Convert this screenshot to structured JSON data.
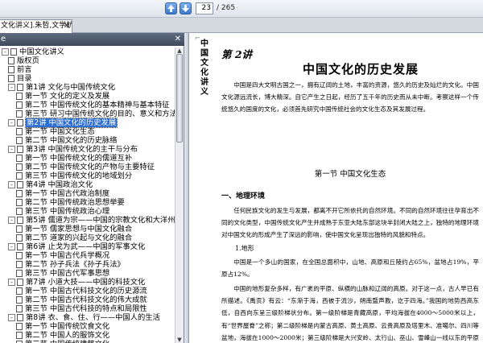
{
  "toolbar": {
    "prev_icon": "arrow-up-icon",
    "next_icon": "arrow-down-icon",
    "page_current": "23",
    "page_total": "/ 265",
    "accent": "#3c78c8"
  },
  "tab": {
    "title": "文化讲义].朱哲,文学航",
    "close": "✕"
  },
  "sidebar": {
    "header": "e",
    "close": "✕",
    "tree": [
      {
        "label": "中国文化讲义",
        "level": 0,
        "expander": "-"
      },
      {
        "label": "版权页",
        "level": 1
      },
      {
        "label": "前言",
        "level": 1
      },
      {
        "label": "目录",
        "level": 1
      },
      {
        "label": "第1讲   文化与中国传统文化",
        "level": 1,
        "expander": "-"
      },
      {
        "label": "第一节   文化的定义及发展",
        "level": 2
      },
      {
        "label": "第二节   中国传统文化的基本精神与基本特征",
        "level": 2
      },
      {
        "label": "第三节   研习中国传统文化的目的、意义和方法",
        "level": 2
      },
      {
        "label": "第2讲   中国文化的历史发展",
        "level": 1,
        "expander": "-",
        "selected": true
      },
      {
        "label": "第一节   中国文化生态",
        "level": 2
      },
      {
        "label": "第二节   中国文化的历史脉络",
        "level": 2
      },
      {
        "label": "第3讲   中国传统文化的主干与分布",
        "level": 1,
        "expander": "-"
      },
      {
        "label": "第一节   中国传统文化的儒道互补",
        "level": 2
      },
      {
        "label": "第二节   中国传统文化的产物与主要特征",
        "level": 2
      },
      {
        "label": "第三节   中国传统文化的地域划分",
        "level": 2
      },
      {
        "label": "第4讲   中国政治文化",
        "level": 1,
        "expander": "-"
      },
      {
        "label": "第一节   中国古代政治制度",
        "level": 2
      },
      {
        "label": "第二节   中国传统政治思想举要",
        "level": 2
      },
      {
        "label": "第三节   中国传统政治心理",
        "level": 2
      },
      {
        "label": "第5讲   儒道为宗——中国的宗教文化和大洋州",
        "level": 1,
        "expander": "-"
      },
      {
        "label": "第一节   儒家思想与中国文化融合",
        "level": 2
      },
      {
        "label": "第二节   道家的兴起与文化的融合",
        "level": 2
      },
      {
        "label": "第6讲   止戈为武——中国的军事文化",
        "level": 1,
        "expander": "-"
      },
      {
        "label": "第一节   中国古代兵学概况",
        "level": 2
      },
      {
        "label": "第二节   孙子兵法《孙子兵法》",
        "level": 2
      },
      {
        "label": "第三节   中国古代军事思想",
        "level": 2
      },
      {
        "label": "第7讲   小道大技——中国的科技文化",
        "level": 1,
        "expander": "-"
      },
      {
        "label": "第一节   中国古代科技文化的历史源流",
        "level": 2
      },
      {
        "label": "第二节   中国古代科技文化的伟大成就",
        "level": 2
      },
      {
        "label": "第三节   中国古代科技的特点和局限性",
        "level": 2
      },
      {
        "label": "第8讲   衣、食、住、行——中国人的生活",
        "level": 1,
        "expander": "-"
      },
      {
        "label": "第一节   中国传统饮食文化",
        "level": 2
      },
      {
        "label": "第二节   中国人的服饰文化",
        "level": 2
      },
      {
        "label": "第三节   中国传统建筑文化",
        "level": 2
      }
    ]
  },
  "document": {
    "corner_mark": "⌐",
    "side_title": "中国文化讲义",
    "chapter_label": "第 2讲",
    "chapter_title": "中国文化的历史发展",
    "intro": "中国是四大文明古国之一，拥有辽阔的土地，丰富的资源，悠久的历史及灿烂的文化。中国文化源远流长，博大精深。自它产生之日起，经历了五千年的历史而从未中断。考察这样一个传统悠久的国度的文化，必须首先研究中国传统社会的文化生态及其发展过程。",
    "section_title": "第一节   中国文化生态",
    "subhead": "一、地理环境",
    "para2": "任何民族文化的发生与发展，都离不开它所依托的自然环境。不同的自然环境往往孕育出不同的文化类型，中国传统文化产生并成熟于东亚大陆东部这块半封闭大陆之上，独特的地理环境对中国文化的形成产生了深远的影响，使中国文化呈现出独特的风貌和特点。",
    "subsub": "1.地形",
    "para3": "中国是一个多山的国家，在全国总面积中，山地、高原和丘陵约占65%，盆地占19%，平原占12%。",
    "para4": "中国的地形复杂多样，有广袤的平原、纵横的山脉和辽阔的高原。对于这一点，古人早已有所描述。《禹贡》有云：“东渐于海，西被于流沙，朔南暨声教，讫于四海。”我国的地势西高东低，自西向东呈三级阶梯状分布。第一级阶梯是青藏高原，平均海拔在4000～5000米以上，有“世界屋脊”之称；第二级阶梯是内蒙古高原、黄土高原、云贵高原及塔里木、准噶尔、四川等盆地，海拔在1000～2000米；第三级阶梯是大兴安岭、太行山、巫山、雪峰山一线以东的平原与丘陵，海拔多在500米以下。"
  }
}
